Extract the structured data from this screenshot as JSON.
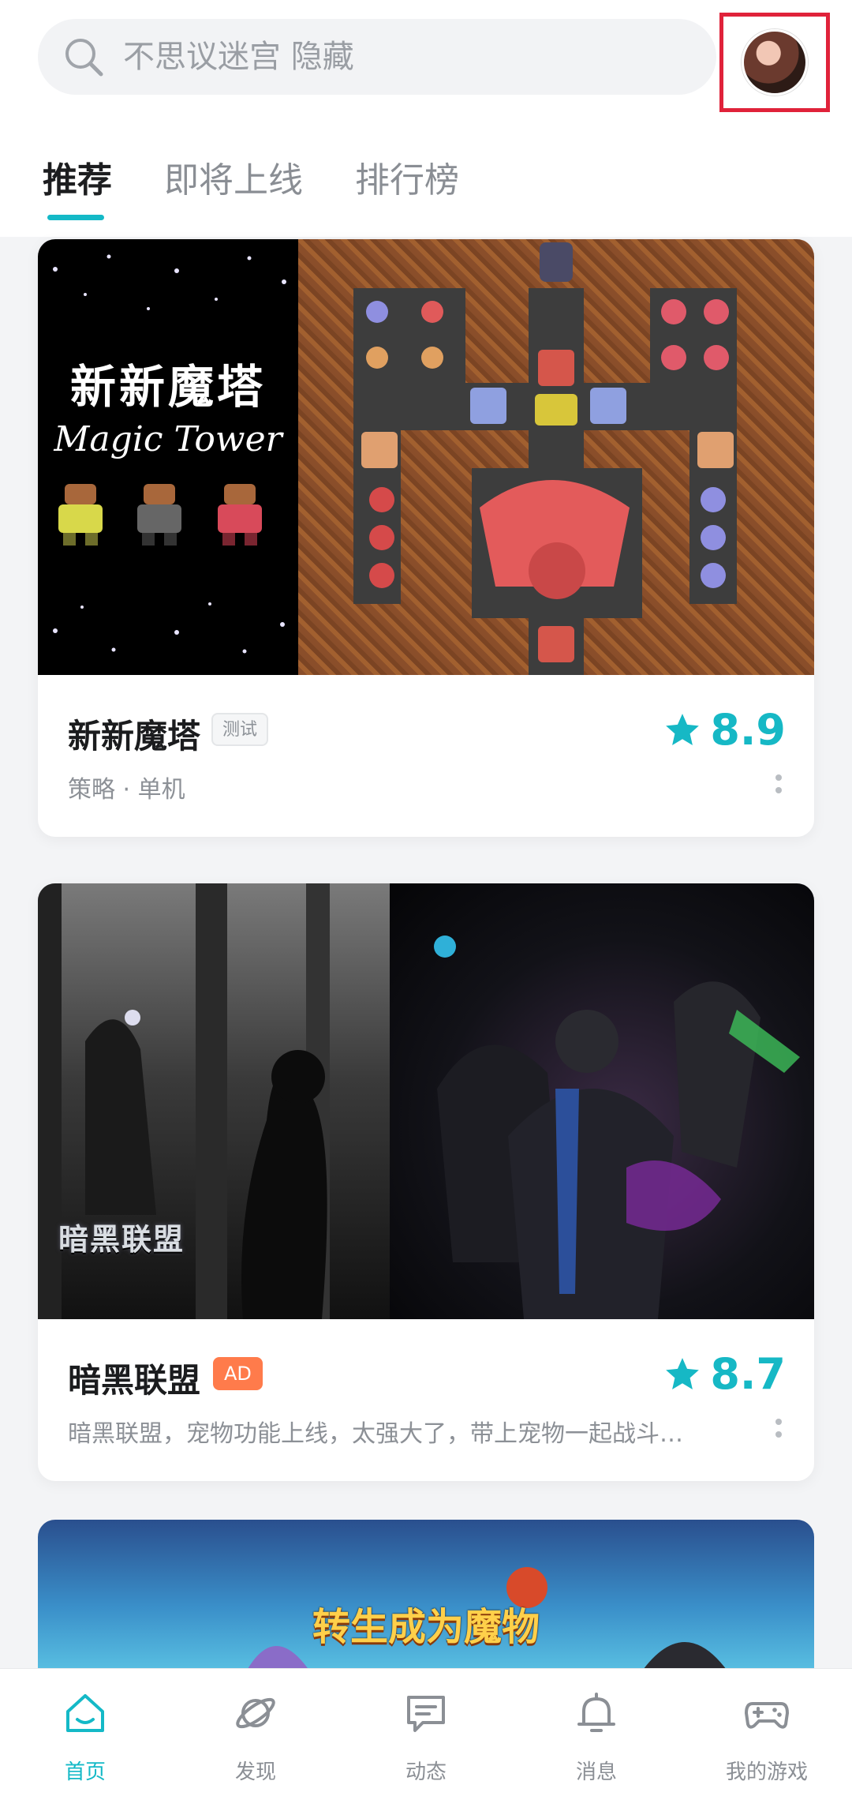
{
  "search": {
    "placeholder": "不思议迷宫 隐藏"
  },
  "tabs": [
    {
      "label": "推荐",
      "active": true
    },
    {
      "label": "即将上线",
      "active": false
    },
    {
      "label": "排行榜",
      "active": false
    }
  ],
  "cards": [
    {
      "title": "新新魔塔",
      "tag": "测试",
      "rating": "8.9",
      "subtitle": "策略 · 单机",
      "banner": {
        "title_cn": "新新魔塔",
        "title_en": "Magic Tower"
      }
    },
    {
      "title": "暗黑联盟",
      "tag": "AD",
      "rating": "8.7",
      "subtitle": "暗黑联盟，宠物功能上线，太强大了，带上宠物一起战斗…",
      "banner": {
        "logo": "暗黑联盟"
      }
    },
    {
      "banner": {
        "title": "转生成为魔物"
      }
    }
  ],
  "bottom_nav": [
    {
      "label": "首页",
      "icon": "home-icon",
      "active": true
    },
    {
      "label": "发现",
      "icon": "planet-icon",
      "active": false
    },
    {
      "label": "动态",
      "icon": "chat-icon",
      "active": false
    },
    {
      "label": "消息",
      "icon": "bell-icon",
      "active": false
    },
    {
      "label": "我的游戏",
      "icon": "gamepad-icon",
      "active": false
    }
  ],
  "colors": {
    "accent": "#14b9c7",
    "highlight": "#e0223a",
    "ad_tag": "#ff7b4b"
  }
}
